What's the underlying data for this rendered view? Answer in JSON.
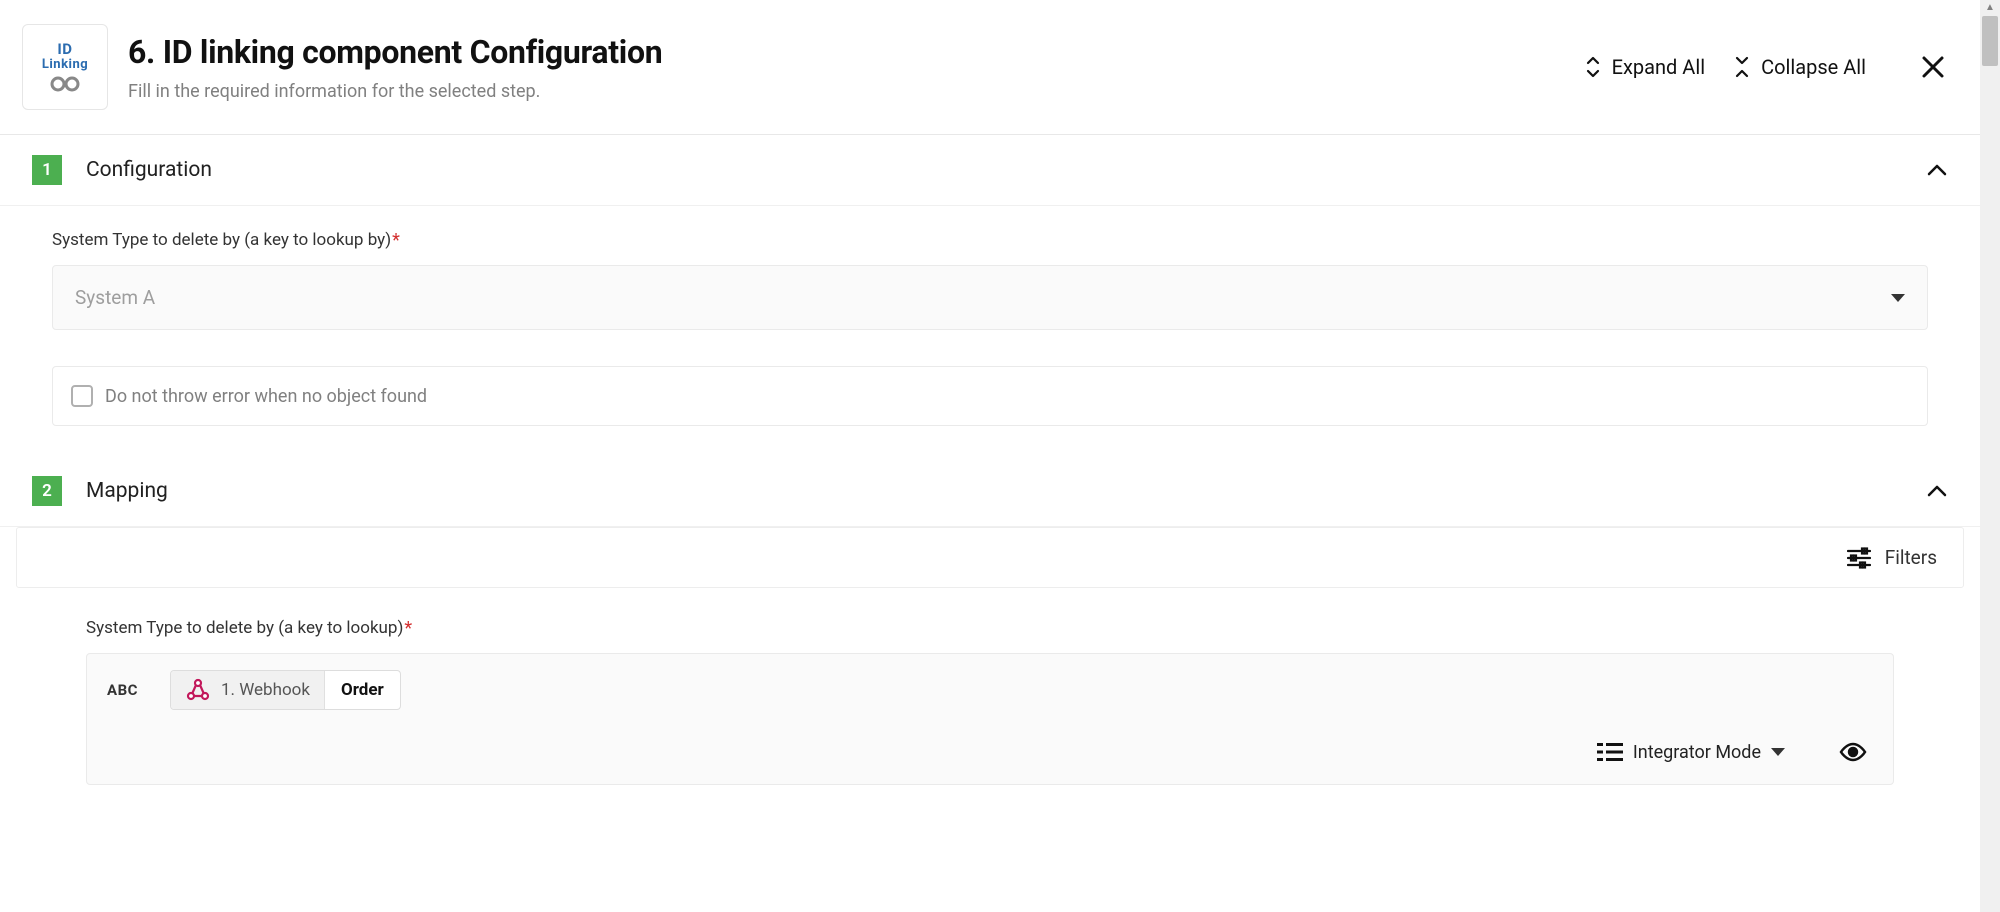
{
  "header": {
    "icon_line1": "ID",
    "icon_line2": "Linking",
    "title": "6. ID linking component Configuration",
    "subtitle": "Fill in the required information for the selected step.",
    "expand_all": "Expand All",
    "collapse_all": "Collapse All"
  },
  "sections": [
    {
      "number": "1",
      "title": "Configuration",
      "field_label": "System Type to delete by (a key to lookup by)",
      "select_placeholder": "System A",
      "checkbox_label": "Do not throw error when no object found"
    },
    {
      "number": "2",
      "title": "Mapping",
      "filters_label": "Filters",
      "field_label": "System Type to delete by (a key to lookup)",
      "abc_label": "ABC",
      "chip_step": "1. Webhook",
      "chip_value": "Order",
      "mode_label": "Integrator Mode"
    }
  ]
}
